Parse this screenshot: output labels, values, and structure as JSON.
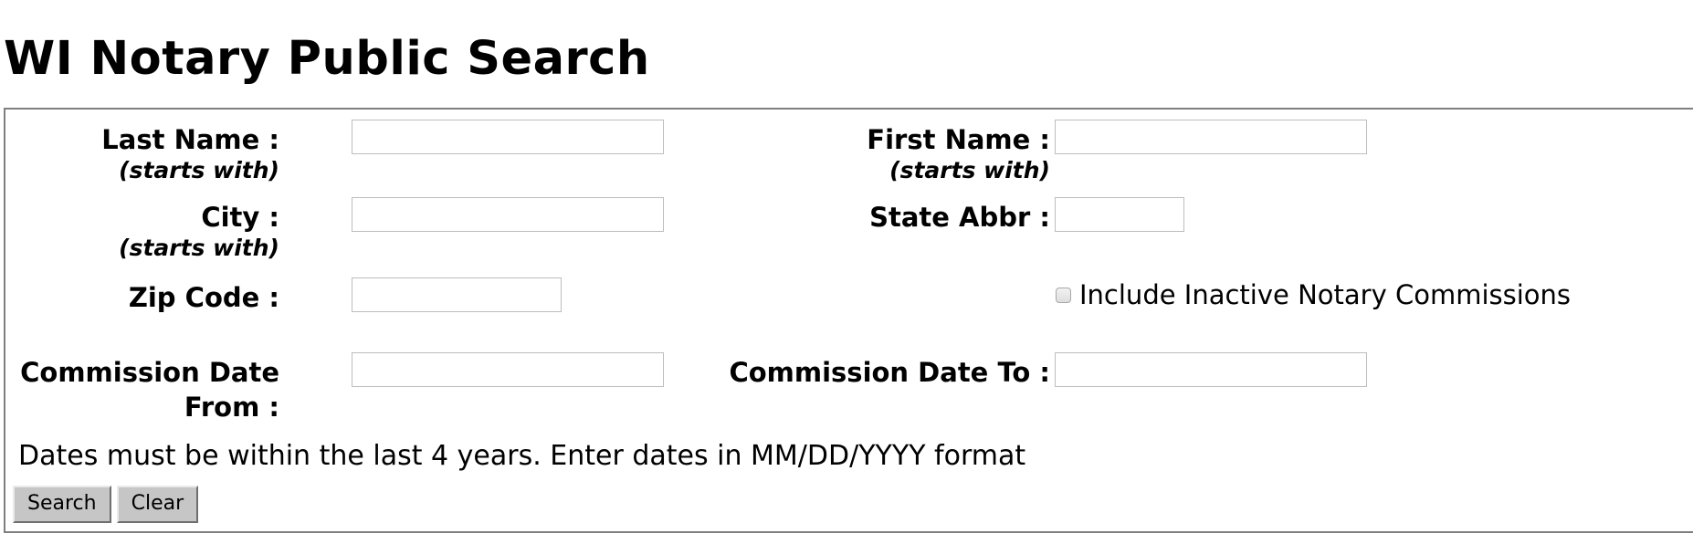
{
  "page": {
    "title": "WI Notary Public Search"
  },
  "form": {
    "fields": {
      "last_name": {
        "label": "Last Name :",
        "hint": "(starts with)",
        "value": "",
        "placeholder": ""
      },
      "first_name": {
        "label": "First Name :",
        "hint": "(starts with)",
        "value": "",
        "placeholder": ""
      },
      "city": {
        "label": "City :",
        "hint": "(starts with)",
        "value": "",
        "placeholder": ""
      },
      "state_abbr": {
        "label": "State Abbr :",
        "value": "",
        "placeholder": ""
      },
      "zip_code": {
        "label": "Zip Code :",
        "value": "",
        "placeholder": ""
      },
      "commission_date_from": {
        "label": "Commission Date From :",
        "value": "",
        "placeholder": ""
      },
      "commission_date_to": {
        "label": "Commission Date To :",
        "value": "",
        "placeholder": ""
      }
    },
    "include_inactive": {
      "label": "Include Inactive Notary Commissions",
      "checked": false
    },
    "note": "Dates must be within the last 4 years. Enter dates in MM/DD/YYYY format",
    "buttons": {
      "search": "Search",
      "clear": "Clear"
    }
  },
  "colors": {
    "panel_border": "#7d8083",
    "input_border": "#bdbdbd",
    "button_face": "#c6c6c6",
    "text": "#000000",
    "background": "#ffffff"
  }
}
